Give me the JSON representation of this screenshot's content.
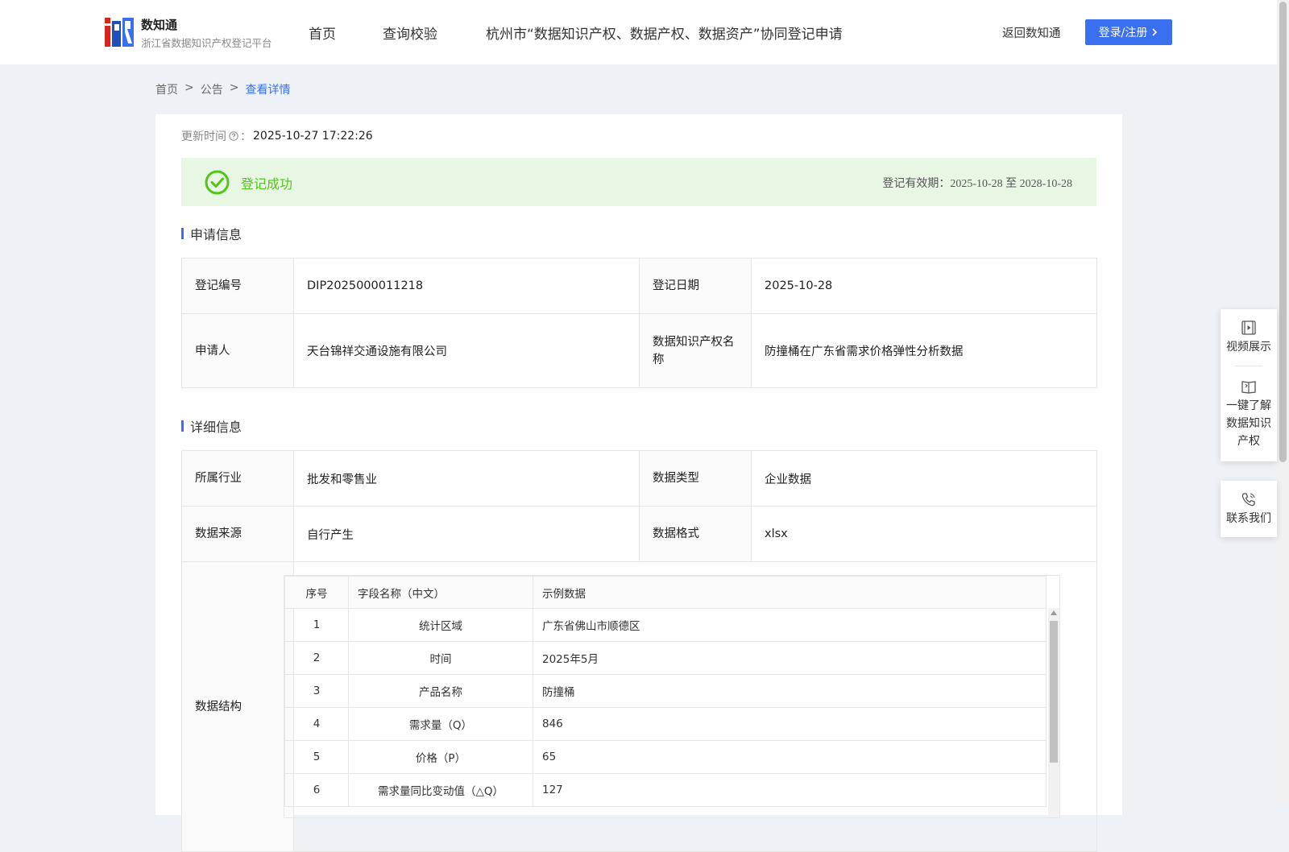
{
  "header": {
    "brand_name": "数知通",
    "brand_subtitle": "浙江省数据知识产权登记平台",
    "nav": [
      "首页",
      "查询校验",
      "杭州市“数据知识产权、数据产权、数据资产”协同登记申请"
    ],
    "back_link": "返回数知通",
    "login_label": "登录/注册"
  },
  "breadcrumb": {
    "home": "首页",
    "sep1": ">",
    "notice": "公告",
    "sep2": ">",
    "current": "查看详情"
  },
  "update": {
    "label": "更新时间",
    "colon": "：",
    "value": "2025-10-27 17:22:26"
  },
  "status": {
    "text": "登记成功",
    "validity_label": "登记有效期：",
    "validity_value": "2025-10-28 至 2028-10-28"
  },
  "sections": {
    "apply": "申请信息",
    "detail": "详细信息"
  },
  "apply_info": {
    "reg_no_label": "登记编号",
    "reg_no": "DIP2025000011218",
    "reg_date_label": "登记日期",
    "reg_date": "2025-10-28",
    "applicant_label": "申请人",
    "applicant": "天台锦祥交通设施有限公司",
    "name_label": "数据知识产权名称",
    "name": "防撞桶在广东省需求价格弹性分析数据"
  },
  "detail_info": {
    "industry_label": "所属行业",
    "industry": "批发和零售业",
    "data_type_label": "数据类型",
    "data_type": "企业数据",
    "source_label": "数据来源",
    "source": "自行产生",
    "format_label": "数据格式",
    "format": "xlsx",
    "structure_label": "数据结构"
  },
  "structure": {
    "headers": [
      "序号",
      "字段名称（中文）",
      "示例数据"
    ],
    "rows": [
      {
        "no": "1",
        "field": "统计区域",
        "sample": "广东省佛山市顺德区"
      },
      {
        "no": "2",
        "field": "时间",
        "sample": "2025年5月"
      },
      {
        "no": "3",
        "field": "产品名称",
        "sample": "防撞桶"
      },
      {
        "no": "4",
        "field": "需求量（Q）",
        "sample": "846"
      },
      {
        "no": "5",
        "field": "价格（P）",
        "sample": "65"
      },
      {
        "no": "6",
        "field": "需求量同比变动值（△Q）",
        "sample": "127"
      }
    ]
  },
  "side_panel": {
    "video": "视频展示",
    "learn": "一键了解数据知识产权",
    "contact": "联系我们"
  },
  "colors": {
    "accent": "#3a6ff0",
    "success": "#52c41a",
    "success_bg": "#e8f7e4"
  }
}
